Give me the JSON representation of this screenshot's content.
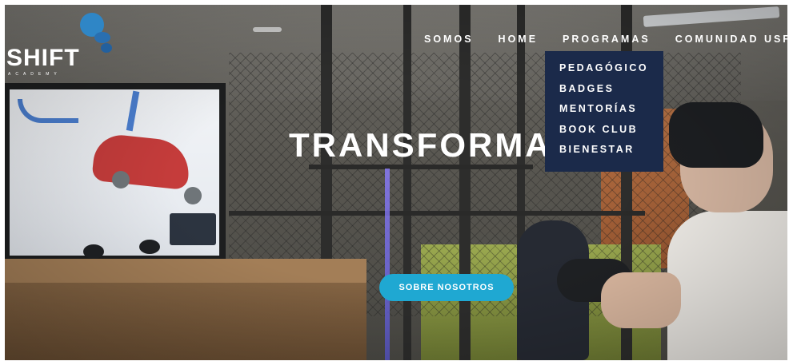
{
  "logo": {
    "text": "SHIFT",
    "subtext": "ACADEMY"
  },
  "nav": {
    "items": [
      {
        "label": "SOMOS"
      },
      {
        "label": "HOME"
      },
      {
        "label": "PROGRAMAS"
      },
      {
        "label": "COMUNIDAD USFQ"
      }
    ]
  },
  "dropdown": {
    "items": [
      {
        "label": "PEDAGÓGICO"
      },
      {
        "label": "BADGES"
      },
      {
        "label": "MENTORÍAS"
      },
      {
        "label": "BOOK CLUB"
      },
      {
        "label": "BIENESTAR"
      }
    ]
  },
  "hero": {
    "title": "TRANSFORMA",
    "cta_label": "SOBRE NOSOTROS"
  },
  "colors": {
    "dropdown_bg": "#1b2a4a",
    "cta_bg": "#1fa8d2",
    "logo_accent": "#2f86c6"
  }
}
